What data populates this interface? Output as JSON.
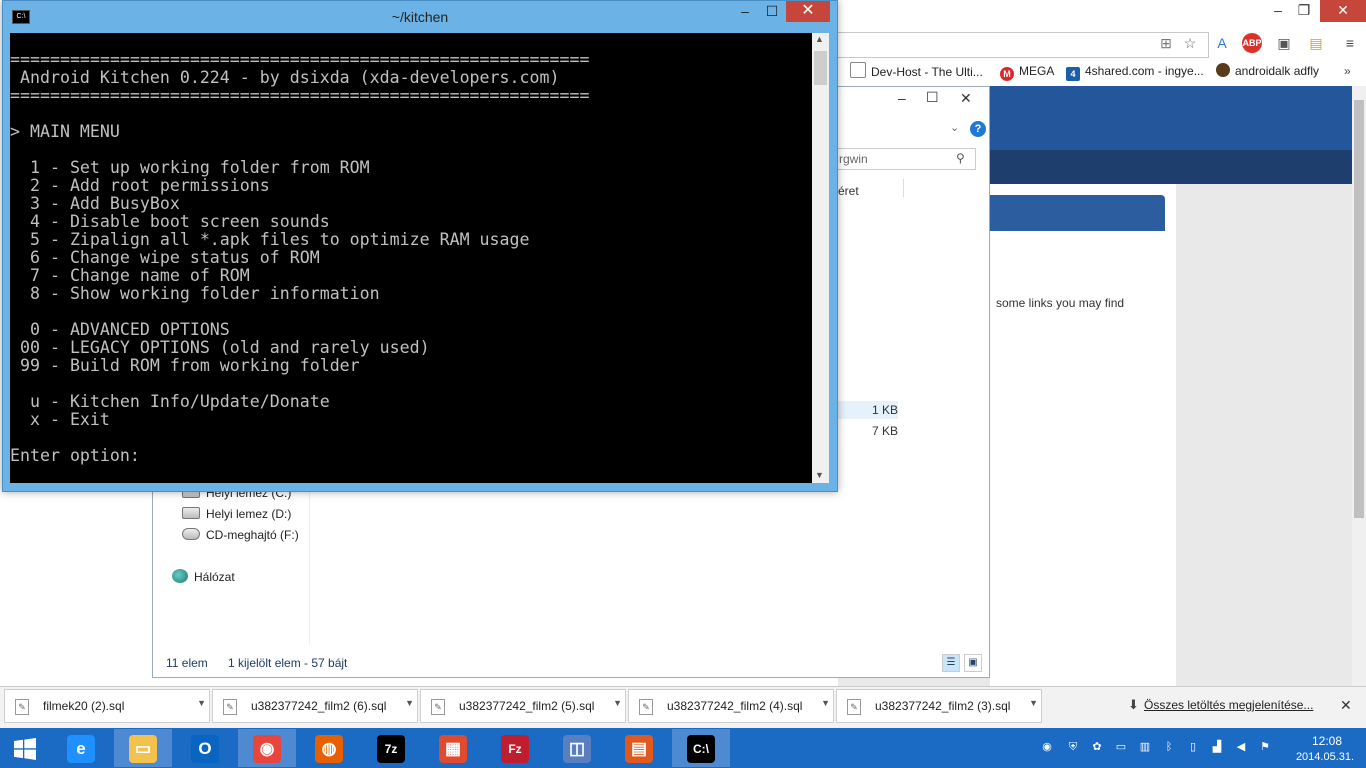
{
  "browser": {
    "bookmarks": [
      {
        "label": "Dev-Host - The Ulti...",
        "icon": "page-icon"
      },
      {
        "label": "MEGA",
        "icon": "mega-icon"
      },
      {
        "label": "4shared.com - ingye...",
        "icon": "4shared-icon"
      },
      {
        "label": "androidalk adfly",
        "icon": "avatar-icon"
      }
    ],
    "page_snippet": "some links you may find"
  },
  "explorer": {
    "search_placeholder": "rgwin",
    "column_partial": "éret",
    "sizes": [
      "1 KB",
      "7 KB"
    ],
    "drives": [
      {
        "label": "Helyi lemez (C:)"
      },
      {
        "label": "Helyi lemez (D:)"
      },
      {
        "label": "CD-meghajtó (F:)"
      }
    ],
    "network": "Hálózat",
    "status_count": "11 elem",
    "status_selection": "1 kijelölt elem - 57 bájt"
  },
  "console": {
    "title": "~/kitchen",
    "output": "\n==========================================================\n Android Kitchen 0.224 - by dsixda (xda-developers.com)\n==========================================================\n\n> MAIN MENU\n\n  1 - Set up working folder from ROM\n  2 - Add root permissions\n  3 - Add BusyBox\n  4 - Disable boot screen sounds\n  5 - Zipalign all *.apk files to optimize RAM usage\n  6 - Change wipe status of ROM\n  7 - Change name of ROM\n  8 - Show working folder information\n\n  0 - ADVANCED OPTIONS\n 00 - LEGACY OPTIONS (old and rarely used)\n 99 - Build ROM from working folder\n\n  u - Kitchen Info/Update/Donate\n  x - Exit\n\nEnter option:"
  },
  "downloads": {
    "items": [
      {
        "name": "filmek20 (2).sql"
      },
      {
        "name": "u382377242_film2 (6).sql"
      },
      {
        "name": "u382377242_film2 (5).sql"
      },
      {
        "name": "u382377242_film2 (4).sql"
      },
      {
        "name": "u382377242_film2 (3).sql"
      }
    ],
    "show_all": "Összes letöltés megjelenítése..."
  },
  "taskbar": {
    "apps": [
      {
        "name": "Internet Explorer",
        "glyph": "e",
        "color": "#1e90ff"
      },
      {
        "name": "File Explorer",
        "glyph": "▭",
        "color": "#f2c14e"
      },
      {
        "name": "Outlook",
        "glyph": "O",
        "color": "#0a64c2"
      },
      {
        "name": "Google Chrome",
        "glyph": "◉",
        "color": "#e8453c"
      },
      {
        "name": "Firefox",
        "glyph": "◍",
        "color": "#e66000"
      },
      {
        "name": "7-Zip",
        "glyph": "7z",
        "color": "#000000"
      },
      {
        "name": "Apps",
        "glyph": "▦",
        "color": "#e04b2f"
      },
      {
        "name": "FileZilla",
        "glyph": "Fz",
        "color": "#bf1e2e"
      },
      {
        "name": "Disk Utility",
        "glyph": "◫",
        "color": "#5a7fc0"
      },
      {
        "name": "Office",
        "glyph": "▤",
        "color": "#e05a1f"
      },
      {
        "name": "Command Prompt",
        "glyph": "C:\\",
        "color": "#000000"
      }
    ],
    "time": "12:08",
    "date": "2014.05.31."
  }
}
